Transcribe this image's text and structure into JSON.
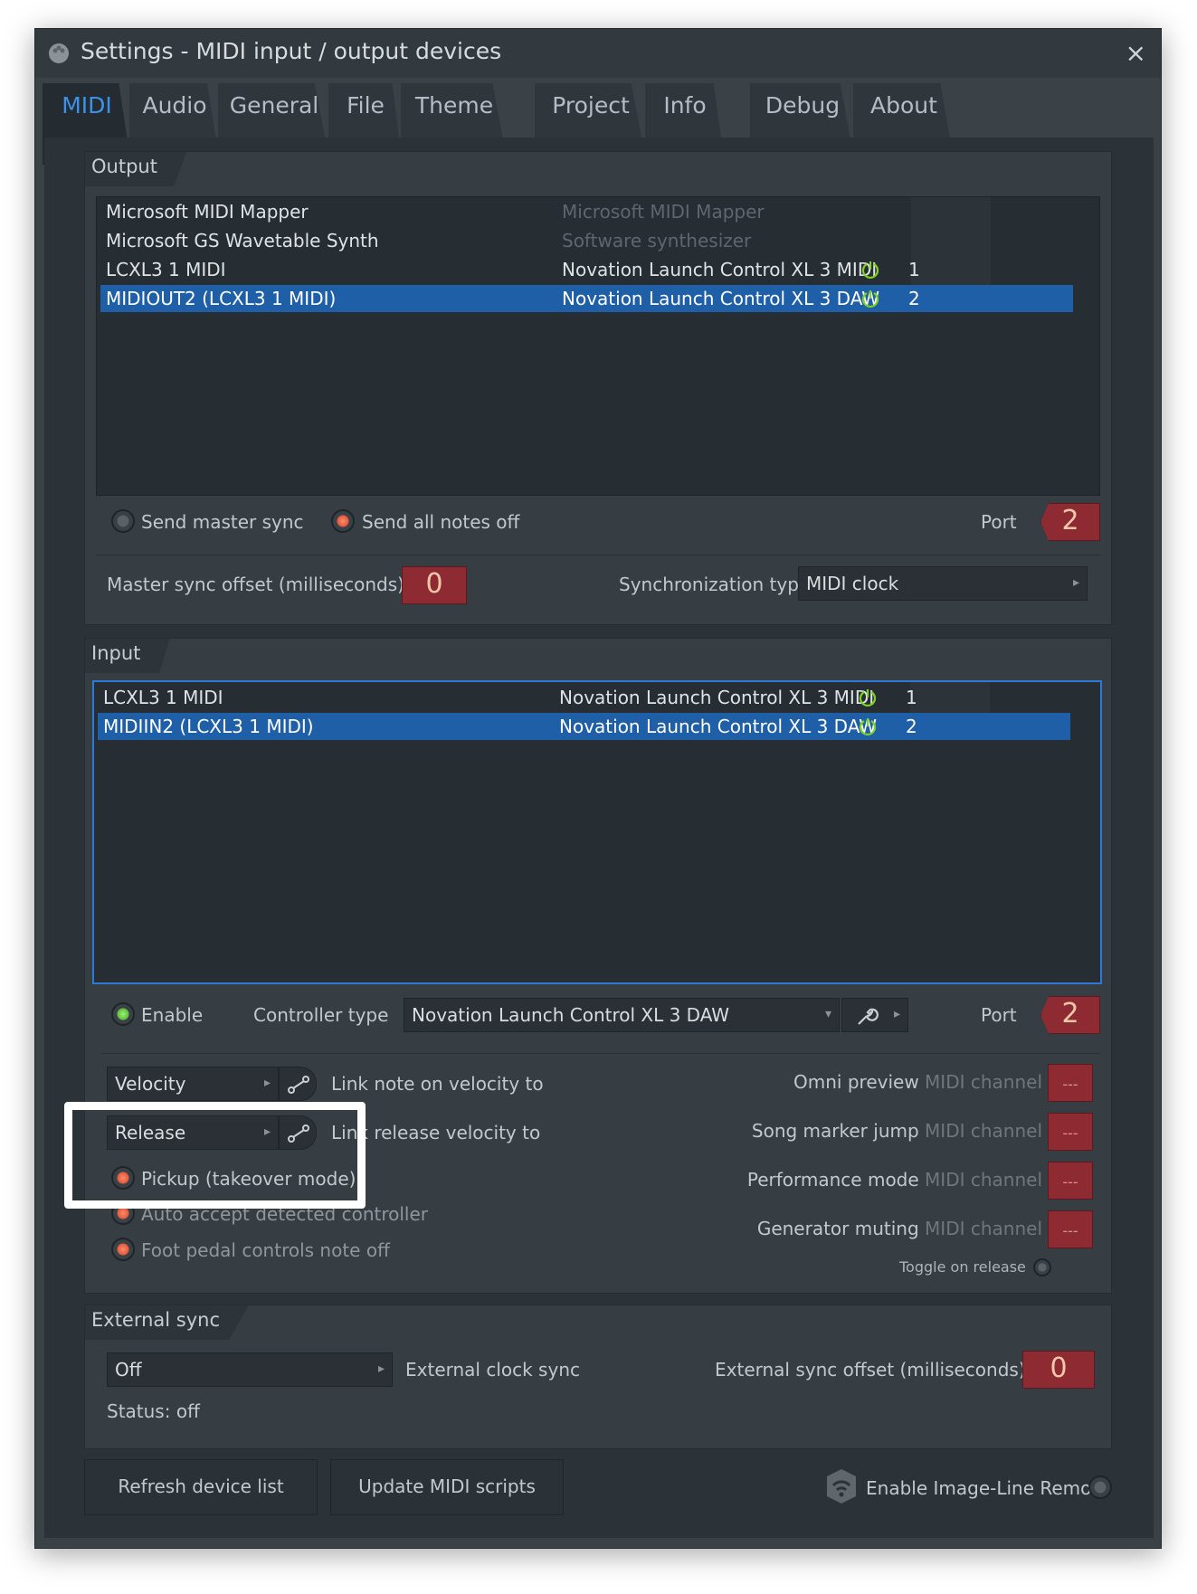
{
  "window": {
    "title": "Settings - MIDI input / output devices",
    "close": "×"
  },
  "tabs": [
    "MIDI",
    "Audio",
    "General",
    "File",
    "Theme",
    "Project",
    "Info",
    "Debug",
    "About"
  ],
  "output": {
    "header": "Output",
    "rows": [
      {
        "name": "Microsoft MIDI Mapper",
        "device": "Microsoft MIDI Mapper",
        "port": "",
        "enabled": false
      },
      {
        "name": "Microsoft GS Wavetable Synth",
        "device": "Software synthesizer",
        "port": "",
        "enabled": false
      },
      {
        "name": "LCXL3 1 MIDI",
        "device": "Novation Launch Control XL 3 MIDI",
        "port": "1",
        "enabled": true
      },
      {
        "name": "MIDIOUT2 (LCXL3 1 MIDI)",
        "device": "Novation Launch Control XL 3 DAW",
        "port": "2",
        "enabled": true
      }
    ],
    "send_master_sync": "Send master sync",
    "send_all_notes_off": "Send all notes off",
    "port_label": "Port",
    "port_value": "2",
    "master_sync_offset_label": "Master sync offset (milliseconds)",
    "master_sync_offset_value": "0",
    "sync_type_label": "Synchronization type",
    "sync_type_value": "MIDI clock"
  },
  "input": {
    "header": "Input",
    "rows": [
      {
        "name": "LCXL3 1 MIDI",
        "device": "Novation Launch Control XL 3 MIDI",
        "port": "1"
      },
      {
        "name": "MIDIIN2 (LCXL3 1 MIDI)",
        "device": "Novation Launch Control XL 3 DAW",
        "port": "2"
      }
    ],
    "enable": "Enable",
    "controller_type_label": "Controller type",
    "controller_type_value": "Novation Launch Control XL 3 DAW",
    "port_label": "Port",
    "port_value": "2",
    "velocity_select": "Velocity",
    "link_velocity": "Link note on velocity to",
    "release_select": "Release",
    "link_release": "Link release velocity to",
    "pickup": "Pickup (takeover mode)",
    "auto_accept": "Auto accept detected controller",
    "foot_pedal": "Foot pedal controls note off",
    "omni_preview": "Omni preview",
    "song_marker_jump": "Song marker jump",
    "performance_mode": "Performance mode",
    "generator_muting": "Generator muting",
    "midi_channel": "MIDI channel",
    "channel_value": "---",
    "toggle_on_release": "Toggle on release"
  },
  "external_sync": {
    "header": "External sync",
    "mode_value": "Off",
    "clock_label": "External clock sync",
    "offset_label": "External sync offset (milliseconds)",
    "offset_value": "0",
    "status": "Status: off"
  },
  "buttons": {
    "refresh": "Refresh device list",
    "update_scripts": "Update MIDI scripts",
    "enable_remote": "Enable Image-Line Remote"
  },
  "colors": {
    "selection": "#1f5fa8",
    "accent_blue": "#3c92e8",
    "value_red": "#8e2b32",
    "power_green": "#7ed321"
  }
}
